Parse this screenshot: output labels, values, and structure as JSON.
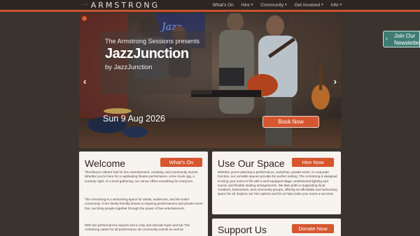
{
  "header": {
    "logo_dots": "···",
    "logo_text": "ARMSTRONG",
    "nav": [
      {
        "label": "What's On",
        "has_caret": false
      },
      {
        "label": "Hire",
        "has_caret": true
      },
      {
        "label": "Community",
        "has_caret": true
      },
      {
        "label": "Get Involved",
        "has_caret": true
      },
      {
        "label": "Info",
        "has_caret": true
      }
    ]
  },
  "hero": {
    "pre_title": "The Armstrong Sessions presents",
    "title": "JazzJunction",
    "byline": "by JazzJunction",
    "date": "Sun 9 Aug 2026",
    "book_label": "Book Now",
    "prev_icon": "chevron-left-icon",
    "next_icon": "chevron-right-icon"
  },
  "newsletter": {
    "line1": "Join Our",
    "line2": "Newsletter",
    "icon": "chevron-right-icon"
  },
  "welcome": {
    "title": "Welcome",
    "button": "What's On",
    "paragraphs": [
      "Thornbury's vibrant hub for live entertainment, creativity, and community events. Whether you're here for a captivating theatre performance, a live music gig, a comedy night, or a local gathering, our venue offers something for everyone.",
      "The Armstrong is a welcoming space for artists, audiences, and the entire community. From family-friendly shows to inspiring performances and private event hire, we bring people together through the power of live entertainment.",
      "With two performances spaces and a cosy and intimate foyer and bar The Armstrong caters for all performance art community events as well as"
    ]
  },
  "space": {
    "title": "Use Our Space",
    "button": "Hire Now",
    "text": "Whether you're planning a performance, workshop, private event, or corporate function, our versatile spaces provide the perfect setting. The Armstrong is designed to bring your event to life with a well-equipped stage, professional lighting and sound, and flexible seating arrangements. We take pride in supporting local creatives, businesses, and community groups, offering an affordable and welcoming space for all. Explore our hire options and let us help make your event a success!"
  },
  "support": {
    "title": "Support Us",
    "button": "Donate Now"
  },
  "colors": {
    "accent": "#d6562f",
    "background": "#3a332e",
    "card": "#f7f3ef",
    "newsletter": "#3f7d74"
  }
}
